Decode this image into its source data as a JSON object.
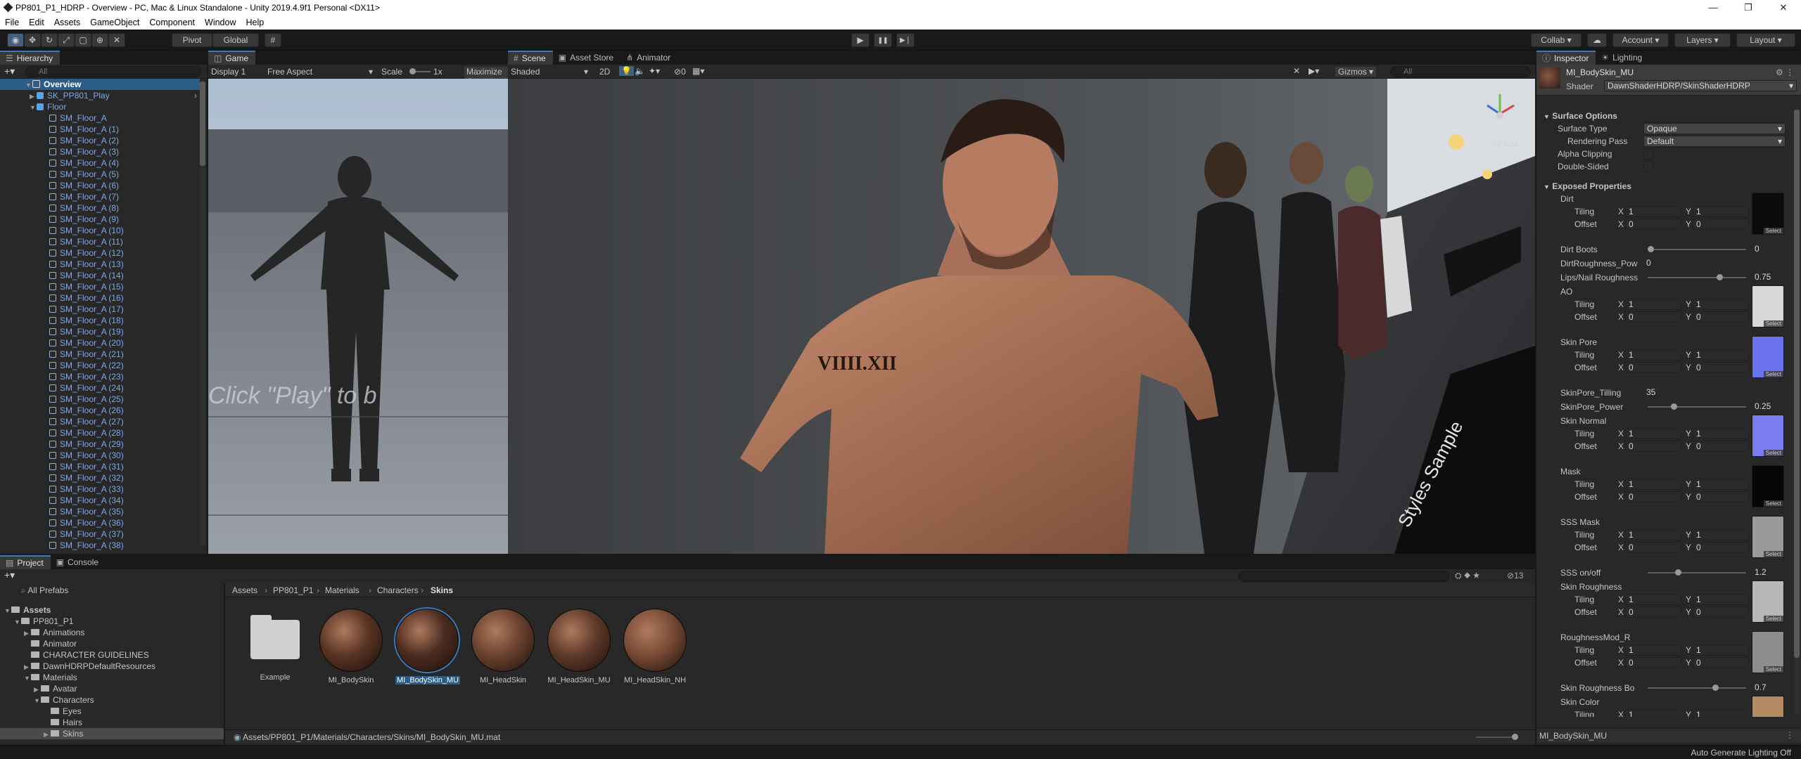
{
  "window": {
    "title": "PP801_P1_HDRP - Overview - PC, Mac & Linux Standalone - Unity 2019.4.9f1 Personal <DX11>",
    "min": "—",
    "max": "❐",
    "close": "✕"
  },
  "menu": [
    "File",
    "Edit",
    "Assets",
    "GameObject",
    "Component",
    "Window",
    "Help"
  ],
  "toolbar": {
    "pivot": "Pivot",
    "global": "Global",
    "collab": "Collab ▾",
    "account": "Account",
    "layers": "Layers",
    "layout": "Layout",
    "play": "▶",
    "pause": "❚❚",
    "step": "▶❘"
  },
  "hierarchy": {
    "tab": "Hierarchy",
    "search_placeholder": "All",
    "scene": "Overview",
    "items": [
      "SK_PP801_Play",
      "Floor",
      "SM_Floor_A",
      "SM_Floor_A (1)",
      "SM_Floor_A (2)",
      "SM_Floor_A (3)",
      "SM_Floor_A (4)",
      "SM_Floor_A (5)",
      "SM_Floor_A (6)",
      "SM_Floor_A (7)",
      "SM_Floor_A (8)",
      "SM_Floor_A (9)",
      "SM_Floor_A (10)",
      "SM_Floor_A (11)",
      "SM_Floor_A (12)",
      "SM_Floor_A (13)",
      "SM_Floor_A (14)",
      "SM_Floor_A (15)",
      "SM_Floor_A (16)",
      "SM_Floor_A (17)",
      "SM_Floor_A (18)",
      "SM_Floor_A (19)",
      "SM_Floor_A (20)",
      "SM_Floor_A (21)",
      "SM_Floor_A (22)",
      "SM_Floor_A (23)",
      "SM_Floor_A (24)",
      "SM_Floor_A (25)",
      "SM_Floor_A (26)",
      "SM_Floor_A (27)",
      "SM_Floor_A (28)",
      "SM_Floor_A (29)",
      "SM_Floor_A (30)",
      "SM_Floor_A (31)",
      "SM_Floor_A (32)",
      "SM_Floor_A (33)",
      "SM_Floor_A (34)",
      "SM_Floor_A (35)",
      "SM_Floor_A (36)",
      "SM_Floor_A (37)",
      "SM_Floor_A (38)"
    ]
  },
  "game": {
    "tab": "Game",
    "display": "Display 1",
    "aspect": "Free Aspect",
    "scale_label": "Scale",
    "scale_value": "1x",
    "maximize": "Maximize O",
    "overlay_text": "Click \"Play\" to b"
  },
  "scene": {
    "tabs": [
      "Scene",
      "Asset Store",
      "Animator"
    ],
    "shading": "Shaded",
    "mode2d": "2D",
    "gizmos": "Gizmos",
    "search_placeholder": "All",
    "persp": "< Persp",
    "tattoo": "VIIII.XII",
    "sign": "Styles Sample",
    "fx_count": "0"
  },
  "inspector": {
    "tabs": [
      "Inspector",
      "Lighting"
    ],
    "material": "MI_BodySkin_MU",
    "shader_label": "Shader",
    "shader": "DawnShaderHDRP/SkinShaderHDRP",
    "surface_header": "Surface Options",
    "surface_type_label": "Surface Type",
    "surface_type": "Opaque",
    "render_pass_label": "Rendering Pass",
    "render_pass": "Default",
    "alpha_clip": "Alpha Clipping",
    "double_sided": "Double-Sided",
    "exposed_header": "Exposed Properties",
    "tiling": "Tiling",
    "offset": "Offset",
    "x": "X",
    "y": "Y",
    "one": "1",
    "zero": "0",
    "select": "Select",
    "tex_props": [
      {
        "name": "Dirt",
        "color": "#0b0b0b"
      },
      {
        "name": "AO",
        "color": "#d8d8d8"
      },
      {
        "name": "Skin Pore",
        "color": "#6b72ef"
      },
      {
        "name": "Skin Normal",
        "color": "#7a7cf0"
      },
      {
        "name": "Mask",
        "color": "#060606"
      },
      {
        "name": "SSS Mask",
        "color": "#9a9a9a"
      },
      {
        "name": "Skin Roughness",
        "color": "#b8b8b8"
      },
      {
        "name": "RoughnessMod_R",
        "color": "#8d8d8d"
      },
      {
        "name": "Skin Color",
        "color": "#b48a63"
      }
    ],
    "dirt_boots": {
      "label": "Dirt Boots",
      "value": "0",
      "level": 0
    },
    "dirt_rough": {
      "label": "DirtRoughness_Pow",
      "value": "0"
    },
    "lips": {
      "label": "Lips/Nail Roughness",
      "value": "0.75",
      "level": 0.75
    },
    "pore_tiling": {
      "label": "SkinPore_Tilling",
      "value": "35"
    },
    "pore_power": {
      "label": "SkinPore_Power",
      "value": "0.25",
      "level": 0.25
    },
    "sss_onoff": {
      "label": "SSS on/off",
      "value": "1.2",
      "level": 0.3
    },
    "skin_rough_bo": {
      "label": "Skin Roughness Bo",
      "value": "0.7",
      "level": 0.7
    },
    "footer": "MI_BodySkin_MU"
  },
  "project": {
    "tabs": [
      "Project",
      "Console"
    ],
    "favorites": [
      "All Prefabs"
    ],
    "tree": [
      "Assets",
      "PP801_P1",
      "Animations",
      "Animator",
      "CHARACTER GUIDELINES",
      "DawnHDRPDefaultResources",
      "Materials",
      "Avatar",
      "Characters",
      "Eyes",
      "Hairs",
      "Skins"
    ],
    "breadcrumb": [
      "Assets",
      "PP801_P1",
      "Materials",
      "Characters",
      "Skins"
    ],
    "assets": [
      {
        "name": "Example",
        "kind": "folder"
      },
      {
        "name": "MI_BodySkin",
        "kind": "mat"
      },
      {
        "name": "MI_BodySkin_MU",
        "kind": "mat",
        "selected": true
      },
      {
        "name": "MI_HeadSkin",
        "kind": "mat"
      },
      {
        "name": "MI_HeadSkin_MU",
        "kind": "mat"
      },
      {
        "name": "MI_HeadSkin_NH",
        "kind": "mat"
      }
    ],
    "path": "Assets/PP801_P1/Materials/Characters/Skins/MI_BodySkin_MU.mat",
    "count": "13"
  },
  "status": {
    "text": "Auto Generate Lighting Off"
  }
}
